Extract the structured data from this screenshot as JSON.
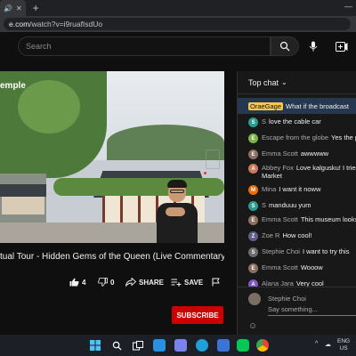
{
  "browser": {
    "tab_icon_names": [
      "speaker-icon",
      "tab-close-icon"
    ],
    "new_tab_label": "+",
    "url_host": "e.com",
    "url_path": "/watch?v=i9ruafIsdUo",
    "window_controls": "—"
  },
  "header": {
    "search_placeholder": "Search",
    "search_icon": "search-icon",
    "mic_icon": "mic-icon",
    "create_icon": "create-video-icon"
  },
  "player": {
    "overlay_title": "emple"
  },
  "video": {
    "title": "tual Tour - Hidden Gems of the Queen (Live Commentary)",
    "like_count": "4",
    "dislike_count": "0",
    "share_label": "SHARE",
    "save_label": "SAVE",
    "subscribe_label": "SUBSCRIBE"
  },
  "chat": {
    "header_label": "Top chat",
    "pinned": {
      "author": "OraeGage",
      "text": "What if the broadcast"
    },
    "messages": [
      {
        "initial": "S",
        "color": "#2a9d8f",
        "author": "S",
        "text": "love the cable car"
      },
      {
        "initial": "E",
        "color": "#7cb342",
        "author": "Escape from the globe",
        "text": "Yes the p"
      },
      {
        "initial": "E",
        "color": "#8d6e63",
        "author": "Emma Scott",
        "text": "awwwww"
      },
      {
        "initial": "A",
        "color": "#c97b5a",
        "author": "Abbey Fox",
        "text": "Love kalgusku! I tried",
        "text2": "Market"
      },
      {
        "initial": "M",
        "color": "#ef6c00",
        "author": "Mina",
        "text": "I want it noww"
      },
      {
        "initial": "S",
        "color": "#2a9d8f",
        "author": "S",
        "text": "manduuu yum"
      },
      {
        "initial": "E",
        "color": "#8d6e63",
        "author": "Emma Scott",
        "text": "This museum looks"
      },
      {
        "initial": "Z",
        "color": "#5e5e8a",
        "author": "Zoe R",
        "text": "How cool!"
      },
      {
        "initial": "S",
        "color": "#6d6d6d",
        "author": "Stephie Choi",
        "text": "I want to try this"
      },
      {
        "initial": "E",
        "color": "#8d6e63",
        "author": "Emma Scott",
        "text": "Wooow"
      },
      {
        "initial": "A",
        "color": "#7e57c2",
        "author": "Alana Jara",
        "text": "Very cool"
      }
    ],
    "input_author": "Stephie Choi",
    "input_placeholder": "Say something..."
  },
  "taskbar": {
    "lang_line1": "ENG",
    "lang_line2": "US",
    "icons": [
      "windows-start-icon",
      "search-icon",
      "task-view-icon",
      "file-explorer-icon",
      "teams-chat-icon",
      "edge-icon",
      "chrome-app-icon",
      "line-app-icon",
      "chrome-icon"
    ]
  }
}
